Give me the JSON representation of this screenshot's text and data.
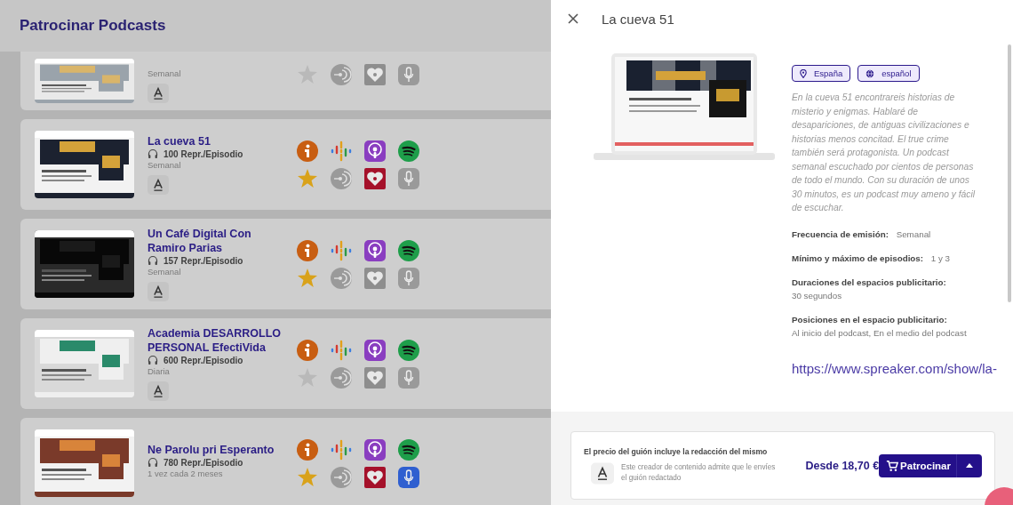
{
  "page": {
    "title": "Patrocinar Podcasts"
  },
  "cards": [
    {
      "partial": true,
      "frequency": "Semanal",
      "platforms": [
        {
          "kind": "star",
          "on": false
        },
        {
          "kind": "signal",
          "on": false
        },
        {
          "kind": "heart",
          "on": false
        },
        {
          "kind": "mic",
          "on": false
        }
      ]
    },
    {
      "partial": false,
      "title": "La cueva 51",
      "plays": "100 Repr./Episodio",
      "frequency": "Semanal",
      "platforms": [
        {
          "kind": "info",
          "on": true
        },
        {
          "kind": "bars",
          "on": true
        },
        {
          "kind": "antenna",
          "on": true
        },
        {
          "kind": "waves",
          "on": true
        },
        {
          "kind": "star",
          "on": true
        },
        {
          "kind": "signal",
          "on": false
        },
        {
          "kind": "heart",
          "on": true
        },
        {
          "kind": "mic",
          "on": false
        }
      ]
    },
    {
      "partial": false,
      "title": "Un Café Digital Con Ramiro Parias",
      "plays": "157 Repr./Episodio",
      "frequency": "Semanal",
      "platforms": [
        {
          "kind": "info",
          "on": true
        },
        {
          "kind": "bars",
          "on": true
        },
        {
          "kind": "antenna",
          "on": true
        },
        {
          "kind": "waves",
          "on": true
        },
        {
          "kind": "star",
          "on": true
        },
        {
          "kind": "signal",
          "on": false
        },
        {
          "kind": "heart",
          "on": false
        },
        {
          "kind": "mic",
          "on": false
        }
      ]
    },
    {
      "partial": false,
      "title": "Academia DESARROLLO PERSONAL EfectiVida",
      "plays": "600 Repr./Episodio",
      "frequency": "Diaria",
      "platforms": [
        {
          "kind": "info",
          "on": true
        },
        {
          "kind": "bars",
          "on": true
        },
        {
          "kind": "antenna",
          "on": true
        },
        {
          "kind": "waves",
          "on": true
        },
        {
          "kind": "star",
          "on": false
        },
        {
          "kind": "signal",
          "on": false
        },
        {
          "kind": "heart",
          "on": false
        },
        {
          "kind": "mic",
          "on": false
        }
      ]
    },
    {
      "partial": false,
      "title": "Ne Parolu pri Esperanto",
      "plays": "780 Repr./Episodio",
      "frequency": "1 vez cada 2 meses",
      "platforms": [
        {
          "kind": "info",
          "on": true
        },
        {
          "kind": "bars",
          "on": true
        },
        {
          "kind": "antenna",
          "on": true
        },
        {
          "kind": "waves",
          "on": true
        },
        {
          "kind": "star",
          "on": true
        },
        {
          "kind": "signal",
          "on": false
        },
        {
          "kind": "heart",
          "on": true
        },
        {
          "kind": "mic",
          "on": true
        }
      ]
    }
  ],
  "panel": {
    "title": "La cueva 51",
    "tags": [
      {
        "kind": "place",
        "label": "España"
      },
      {
        "kind": "language",
        "label": "español"
      }
    ],
    "description": "En la cueva 51 encontrareis historias de misterio y enigmas. Hablaré de desapariciones, de antiguas civilizaciones e historias menos concitad. El true crime también será protagonista. Un podcast semanal escuchado por cientos de personas de todo el mundo. Con su duración de unos 30 minutos, es un podcast muy ameno y fácil de escuchar.",
    "details": [
      {
        "kind": "inline",
        "label": "Frecuencia de emisión:",
        "value": "Semanal"
      },
      {
        "kind": "inline",
        "label": "Mínimo y máximo de episodios:",
        "value": "1 y 3"
      },
      {
        "kind": "block",
        "label": "Duraciones del espacios publicitario:",
        "value": "30 segundos"
      },
      {
        "kind": "block",
        "label": "Posiciones en el espacio publicitario:",
        "value": "Al inicio del podcast, En el medio del podcast"
      }
    ],
    "link": "https://www.spreaker.com/show/la-",
    "footer": {
      "heading": "El precio del guión incluye la redacción del mismo",
      "note": "Este creador de contenido admite que le envíes el guión redactado",
      "price": "Desde 18,70 €",
      "button": "Patrocinar"
    }
  }
}
